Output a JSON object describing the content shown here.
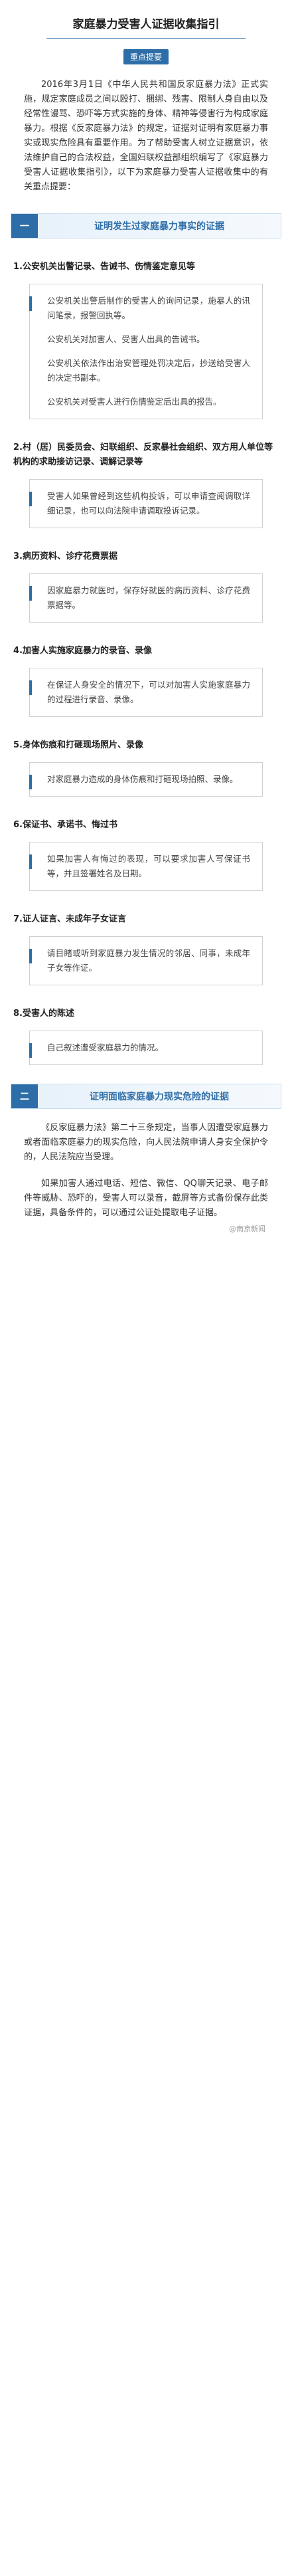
{
  "title": "家庭暴力受害人证据收集指引",
  "tag": "重点提要",
  "intro": "2016年3月1日《中华人民共和国反家庭暴力法》正式实施，规定家庭成员之间以殴打、捆绑、残害、限制人身自由以及经常性谩骂、恐吓等方式实施的身体、精神等侵害行为构成家庭暴力。根据《反家庭暴力法》的规定，证据对证明有家庭暴力事实或现实危险具有重要作用。为了帮助受害人树立证据意识，依法维护自己的合法权益，全国妇联权益部组织编写了《家庭暴力受害人证据收集指引》，以下为家庭暴力受害人证据收集中的有关重点提要：",
  "section1": {
    "num": "一",
    "title": "证明发生过家庭暴力事实的证据",
    "items": [
      {
        "heading": "1.公安机关出警记录、告诫书、伤情鉴定意见等",
        "paras": [
          "公安机关出警后制作的受害人的询问记录，施暴人的讯问笔录，报警回执等。",
          "公安机关对加害人、受害人出具的告诫书。",
          "公安机关依法作出治安管理处罚决定后，抄送给受害人的决定书副本。",
          "公安机关对受害人进行伤情鉴定后出具的报告。"
        ]
      },
      {
        "heading": "2.村（居）民委员会、妇联组织、反家暴社会组织、双方用人单位等机构的求助接访记录、调解记录等",
        "paras": [
          "受害人如果曾经到这些机构投诉，可以申请查阅调取详细记录，也可以向法院申请调取投诉记录。"
        ]
      },
      {
        "heading": "3.病历资料、诊疗花费票据",
        "paras": [
          "因家庭暴力就医时，保存好就医的病历资料、诊疗花费票据等。"
        ]
      },
      {
        "heading": "4.加害人实施家庭暴力的录音、录像",
        "paras": [
          "在保证人身安全的情况下，可以对加害人实施家庭暴力的过程进行录音、录像。"
        ]
      },
      {
        "heading": "5.身体伤痕和打砸现场照片、录像",
        "paras": [
          "对家庭暴力造成的身体伤痕和打砸现场拍照、录像。"
        ]
      },
      {
        "heading": "6.保证书、承诺书、悔过书",
        "paras": [
          "如果加害人有悔过的表现，可以要求加害人写保证书等，并且签署姓名及日期。"
        ]
      },
      {
        "heading": "7.证人证言、未成年子女证言",
        "paras": [
          "请目睹或听到家庭暴力发生情况的邻居、同事，未成年子女等作证。"
        ]
      },
      {
        "heading": "8.受害人的陈述",
        "paras": [
          "自己叙述遭受家庭暴力的情况。"
        ]
      }
    ]
  },
  "section2": {
    "num": "二",
    "title": "证明面临家庭暴力现实危险的证据",
    "paras": [
      "《反家庭暴力法》第二十三条规定，当事人因遭受家庭暴力或者面临家庭暴力的现实危险，向人民法院申请人身安全保护令的，人民法院应当受理。",
      "如果加害人通过电话、短信、微信、QQ聊天记录、电子邮件等威胁、恐吓的，受害人可以录音，截屏等方式备份保存此类证据，具备条件的，可以通过公证处提取电子证据。"
    ]
  },
  "watermark": "@南京新闻"
}
